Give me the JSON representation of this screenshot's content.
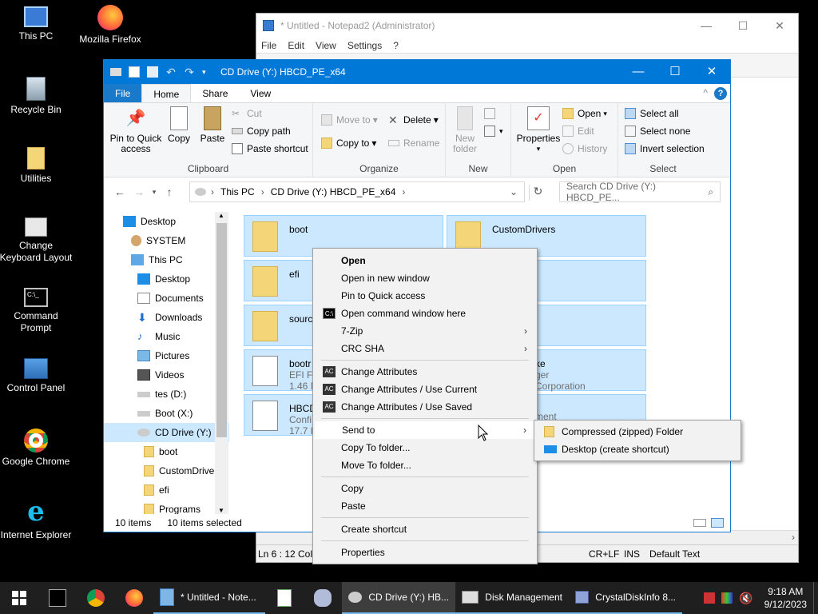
{
  "desktop": {
    "icons": [
      {
        "label": "This PC",
        "icon": "computer-icon"
      },
      {
        "label": "Mozilla Firefox",
        "icon": "firefox-icon"
      },
      {
        "label": "Recycle Bin",
        "icon": "recycle-bin-icon"
      },
      {
        "label": "Utilities",
        "icon": "folder-icon"
      },
      {
        "label": "Change Keyboard Layout",
        "icon": "keyboard-settings-icon"
      },
      {
        "label": "Command Prompt",
        "icon": "command-prompt-icon"
      },
      {
        "label": "Control Panel",
        "icon": "control-panel-icon"
      },
      {
        "label": "Google Chrome",
        "icon": "chrome-icon"
      },
      {
        "label": "Internet Explorer",
        "icon": "internet-explorer-icon"
      }
    ]
  },
  "notepad": {
    "title": "* Untitled - Notepad2 (Administrator)",
    "menu": [
      "File",
      "Edit",
      "View",
      "Settings",
      "?"
    ],
    "status": {
      "position": "Ln 6 : 12",
      "col": "Col",
      "eol": "CR+LF",
      "ins": "INS",
      "scheme": "Default Text"
    }
  },
  "explorer": {
    "title": "CD Drive (Y:) HBCD_PE_x64",
    "tabs": {
      "file": "File",
      "home": "Home",
      "share": "Share",
      "view": "View"
    },
    "ribbon": {
      "clipboard": {
        "pin": "Pin to Quick access",
        "copy": "Copy",
        "paste": "Paste",
        "cut": "Cut",
        "copy_path": "Copy path",
        "paste_shortcut": "Paste shortcut",
        "group": "Clipboard"
      },
      "organize": {
        "move_to": "Move to",
        "copy_to": "Copy to",
        "delete": "Delete",
        "rename": "Rename",
        "group": "Organize"
      },
      "new": {
        "new_folder": "New folder",
        "group": "New"
      },
      "open": {
        "properties": "Properties",
        "open": "Open",
        "edit": "Edit",
        "history": "History",
        "group": "Open"
      },
      "select": {
        "select_all": "Select all",
        "select_none": "Select none",
        "invert": "Invert selection",
        "group": "Select"
      }
    },
    "address": {
      "crumbs": [
        "This PC",
        "CD Drive (Y:) HBCD_PE_x64"
      ]
    },
    "search": {
      "placeholder": "Search CD Drive (Y:) HBCD_PE..."
    },
    "nav": [
      {
        "label": "Desktop",
        "indent": 0
      },
      {
        "label": "SYSTEM",
        "indent": 0
      },
      {
        "label": "This PC",
        "indent": 0
      },
      {
        "label": "Desktop",
        "indent": 1
      },
      {
        "label": "Documents",
        "indent": 1
      },
      {
        "label": "Downloads",
        "indent": 1
      },
      {
        "label": "Music",
        "indent": 1
      },
      {
        "label": "Pictures",
        "indent": 1
      },
      {
        "label": "Videos",
        "indent": 1
      },
      {
        "label": "tes (D:)",
        "indent": 1
      },
      {
        "label": "Boot (X:)",
        "indent": 1
      },
      {
        "label": "CD Drive (Y:) H",
        "indent": 1
      },
      {
        "label": "boot",
        "indent": 2
      },
      {
        "label": "CustomDrive",
        "indent": 2
      },
      {
        "label": "efi",
        "indent": 2
      },
      {
        "label": "Programs",
        "indent": 2
      }
    ],
    "files": [
      {
        "name": "boot",
        "sub1": "",
        "sub2": ""
      },
      {
        "name": "CustomDrivers",
        "sub1": "",
        "sub2": ""
      },
      {
        "name": "efi",
        "sub1": "",
        "sub2": ""
      },
      {
        "name": "",
        "sub1": "",
        "sub2": ""
      },
      {
        "name": "sourc",
        "sub1": "",
        "sub2": ""
      },
      {
        "name": "",
        "sub1": "",
        "sub2": ""
      },
      {
        "name": "bootr",
        "sub1": "EFI Fil",
        "sub2": "1.46 M"
      },
      {
        "name": "ke",
        "sub1": "ger",
        "sub2": "Corporation"
      },
      {
        "name": "HBCD",
        "sub1": "Confi",
        "sub2": "17.7 K"
      },
      {
        "name": "",
        "sub1": "ment",
        "sub2": ""
      }
    ],
    "status": {
      "count": "10 items",
      "selected": "10 items selected"
    }
  },
  "context_menu": {
    "items": [
      {
        "label": "Open",
        "bold": true
      },
      {
        "label": "Open in new window"
      },
      {
        "label": "Pin to Quick access"
      },
      {
        "label": "Open command window here"
      },
      {
        "label": "7-Zip"
      },
      {
        "label": "CRC SHA"
      },
      {
        "label": "Change Attributes"
      },
      {
        "label": "Change Attributes / Use Current"
      },
      {
        "label": "Change Attributes / Use Saved"
      },
      {
        "label": "Send to"
      },
      {
        "label": "Copy To folder..."
      },
      {
        "label": "Move To folder..."
      },
      {
        "label": "Copy"
      },
      {
        "label": "Paste"
      },
      {
        "label": "Create shortcut"
      },
      {
        "label": "Properties"
      }
    ],
    "submenu": [
      {
        "label": "Compressed (zipped) Folder"
      },
      {
        "label": "Desktop (create shortcut)"
      }
    ]
  },
  "taskbar": {
    "items": [
      {
        "label": "",
        "icon": "command-prompt-icon"
      },
      {
        "label": "",
        "icon": "chrome-icon"
      },
      {
        "label": "",
        "icon": "firefox-icon"
      },
      {
        "label": "* Untitled - Note...",
        "icon": "notepad-icon"
      },
      {
        "label": "",
        "icon": "text-editor-icon"
      },
      {
        "label": "",
        "icon": "tool-icon"
      },
      {
        "label": "CD Drive (Y:) HB...",
        "icon": "cd-drive-icon"
      },
      {
        "label": "Disk Management",
        "icon": "disk-management-icon"
      },
      {
        "label": "CrystalDiskInfo 8...",
        "icon": "crystaldiskinfo-icon"
      }
    ],
    "time": "9:18 AM",
    "date": "9/12/2023"
  },
  "colors": {
    "accent": "#0078d7",
    "selection": "#cce8ff",
    "selection_border": "#99d1ff",
    "taskbar": "#1f1f1f",
    "folder": "#f4d577"
  }
}
